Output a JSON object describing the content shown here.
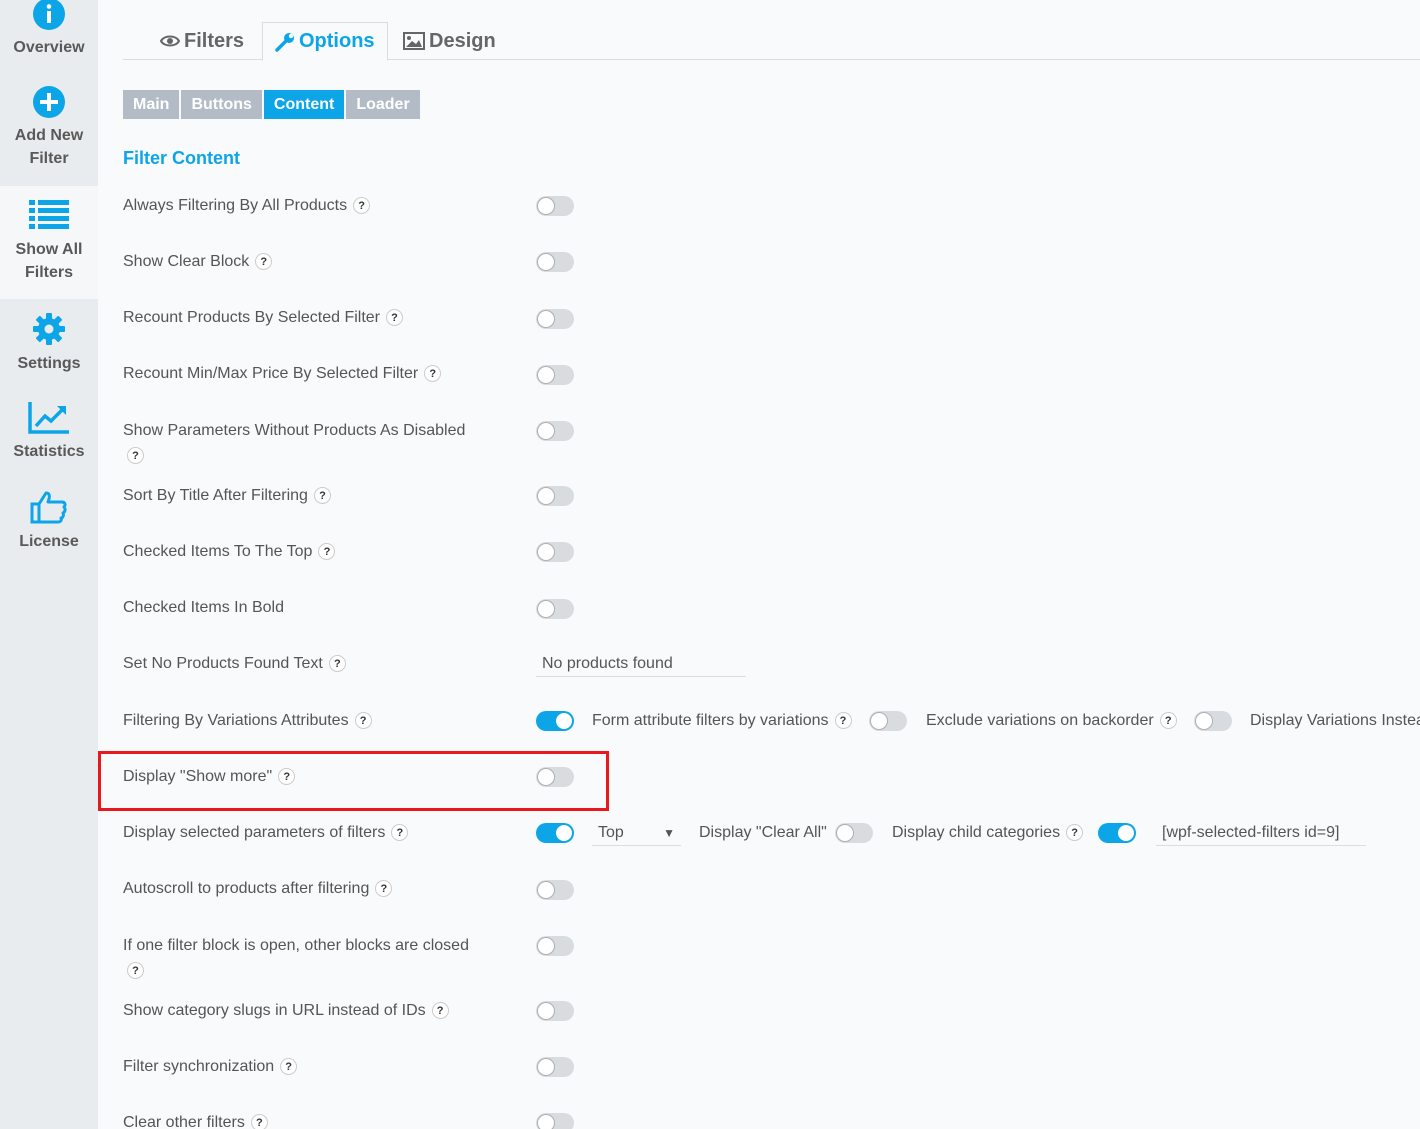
{
  "sidebar": {
    "items": [
      {
        "label": "Overview",
        "icon": "info-icon"
      },
      {
        "label": "Add New Filter",
        "icon": "plus-circle-icon"
      },
      {
        "label": "Show All Filters",
        "icon": "list-icon",
        "active": true
      },
      {
        "label": "Settings",
        "icon": "gear-icon"
      },
      {
        "label": "Statistics",
        "icon": "chart-trend-icon"
      },
      {
        "label": "License",
        "icon": "thumbs-up-icon"
      }
    ]
  },
  "tabs": [
    {
      "label": "Filters",
      "icon": "eye-icon"
    },
    {
      "label": "Options",
      "icon": "wrench-icon",
      "active": true
    },
    {
      "label": "Design",
      "icon": "image-icon"
    }
  ],
  "subtabs": [
    {
      "label": "Main"
    },
    {
      "label": "Buttons"
    },
    {
      "label": "Content",
      "active": true
    },
    {
      "label": "Loader"
    }
  ],
  "section_title": "Filter Content",
  "rows": [
    {
      "label": "Always Filtering By All Products",
      "enabled": false
    },
    {
      "label": "Show Clear Block",
      "enabled": false
    },
    {
      "label": "Recount Products By Selected Filter",
      "enabled": false
    },
    {
      "label": "Recount Min/Max Price By Selected Filter",
      "enabled": false
    },
    {
      "label": "Show Parameters Without Products As Disabled",
      "enabled": false
    },
    {
      "label": "Sort By Title After Filtering",
      "enabled": false
    },
    {
      "label": "Checked Items To The Top",
      "enabled": false
    },
    {
      "label": "Checked Items In Bold",
      "enabled": false
    },
    {
      "label": "Set No Products Found Text",
      "input_value": "No products found"
    },
    {
      "label": "Filtering By Variations Attributes",
      "enabled": true,
      "extra": [
        {
          "label": "Form attribute filters by variations",
          "enabled": false
        },
        {
          "label": "Exclude variations on backorder",
          "enabled": false
        },
        {
          "label": "Display Variations Instead of Products"
        }
      ]
    },
    {
      "label": "Display \"Show more\"",
      "enabled": false
    },
    {
      "label": "Display selected parameters of filters",
      "enabled": true,
      "position_select": "Top",
      "clear_all_label": "Display \"Clear All\"",
      "clear_all_enabled": false,
      "child_cat_label": "Display child categories",
      "child_cat_enabled": true,
      "shortcode": "[wpf-selected-filters id=9]"
    },
    {
      "label": "Autoscroll to products after filtering",
      "enabled": false
    },
    {
      "label": "If one filter block is open, other blocks are closed",
      "enabled": false
    },
    {
      "label": "Show category slugs in URL instead of IDs",
      "enabled": false
    },
    {
      "label": "Filter synchronization",
      "enabled": false
    },
    {
      "label": "Clear other filters",
      "enabled": false
    }
  ],
  "help_glyph": "?",
  "colors": {
    "accent": "#0ba5e8",
    "sidebar_bg": "#e9ecef",
    "highlight": "#e8191c",
    "subtab_inactive": "#b3bcc6"
  }
}
